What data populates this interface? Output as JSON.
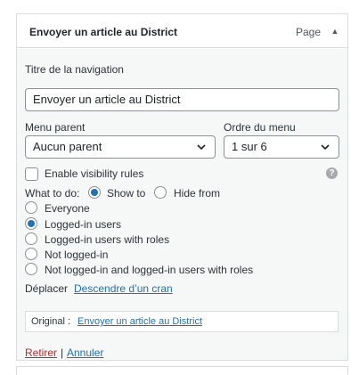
{
  "item": {
    "title": "Envoyer un article au District",
    "type": "Page",
    "toggle_glyph": "▲"
  },
  "fields": {
    "navigation_label": "Titre de la navigation",
    "navigation_value": "Envoyer un article au District",
    "parent_label": "Menu parent",
    "parent_value": "Aucun parent",
    "order_label": "Ordre du menu",
    "order_value": "1 sur 6"
  },
  "visibility": {
    "enable_label": "Enable visibility rules",
    "enabled": false,
    "help_glyph": "?",
    "what_to_do_label": "What to do:",
    "actions": [
      {
        "label": "Show to",
        "checked": true
      },
      {
        "label": "Hide from",
        "checked": false
      }
    ],
    "rules": [
      {
        "label": "Everyone",
        "checked": false
      },
      {
        "label": "Logged-in users",
        "checked": true
      },
      {
        "label": "Logged-in users with roles",
        "checked": false
      },
      {
        "label": "Not logged-in",
        "checked": false
      },
      {
        "label": "Not logged-in and logged-in users with roles",
        "checked": false
      }
    ]
  },
  "move": {
    "label": "Déplacer",
    "link": "Descendre d’un cran"
  },
  "original": {
    "label": "Original :",
    "link": "Envoyer un article au District"
  },
  "actions_footer": {
    "remove": "Retirer",
    "separator": "|",
    "cancel": "Annuler"
  }
}
